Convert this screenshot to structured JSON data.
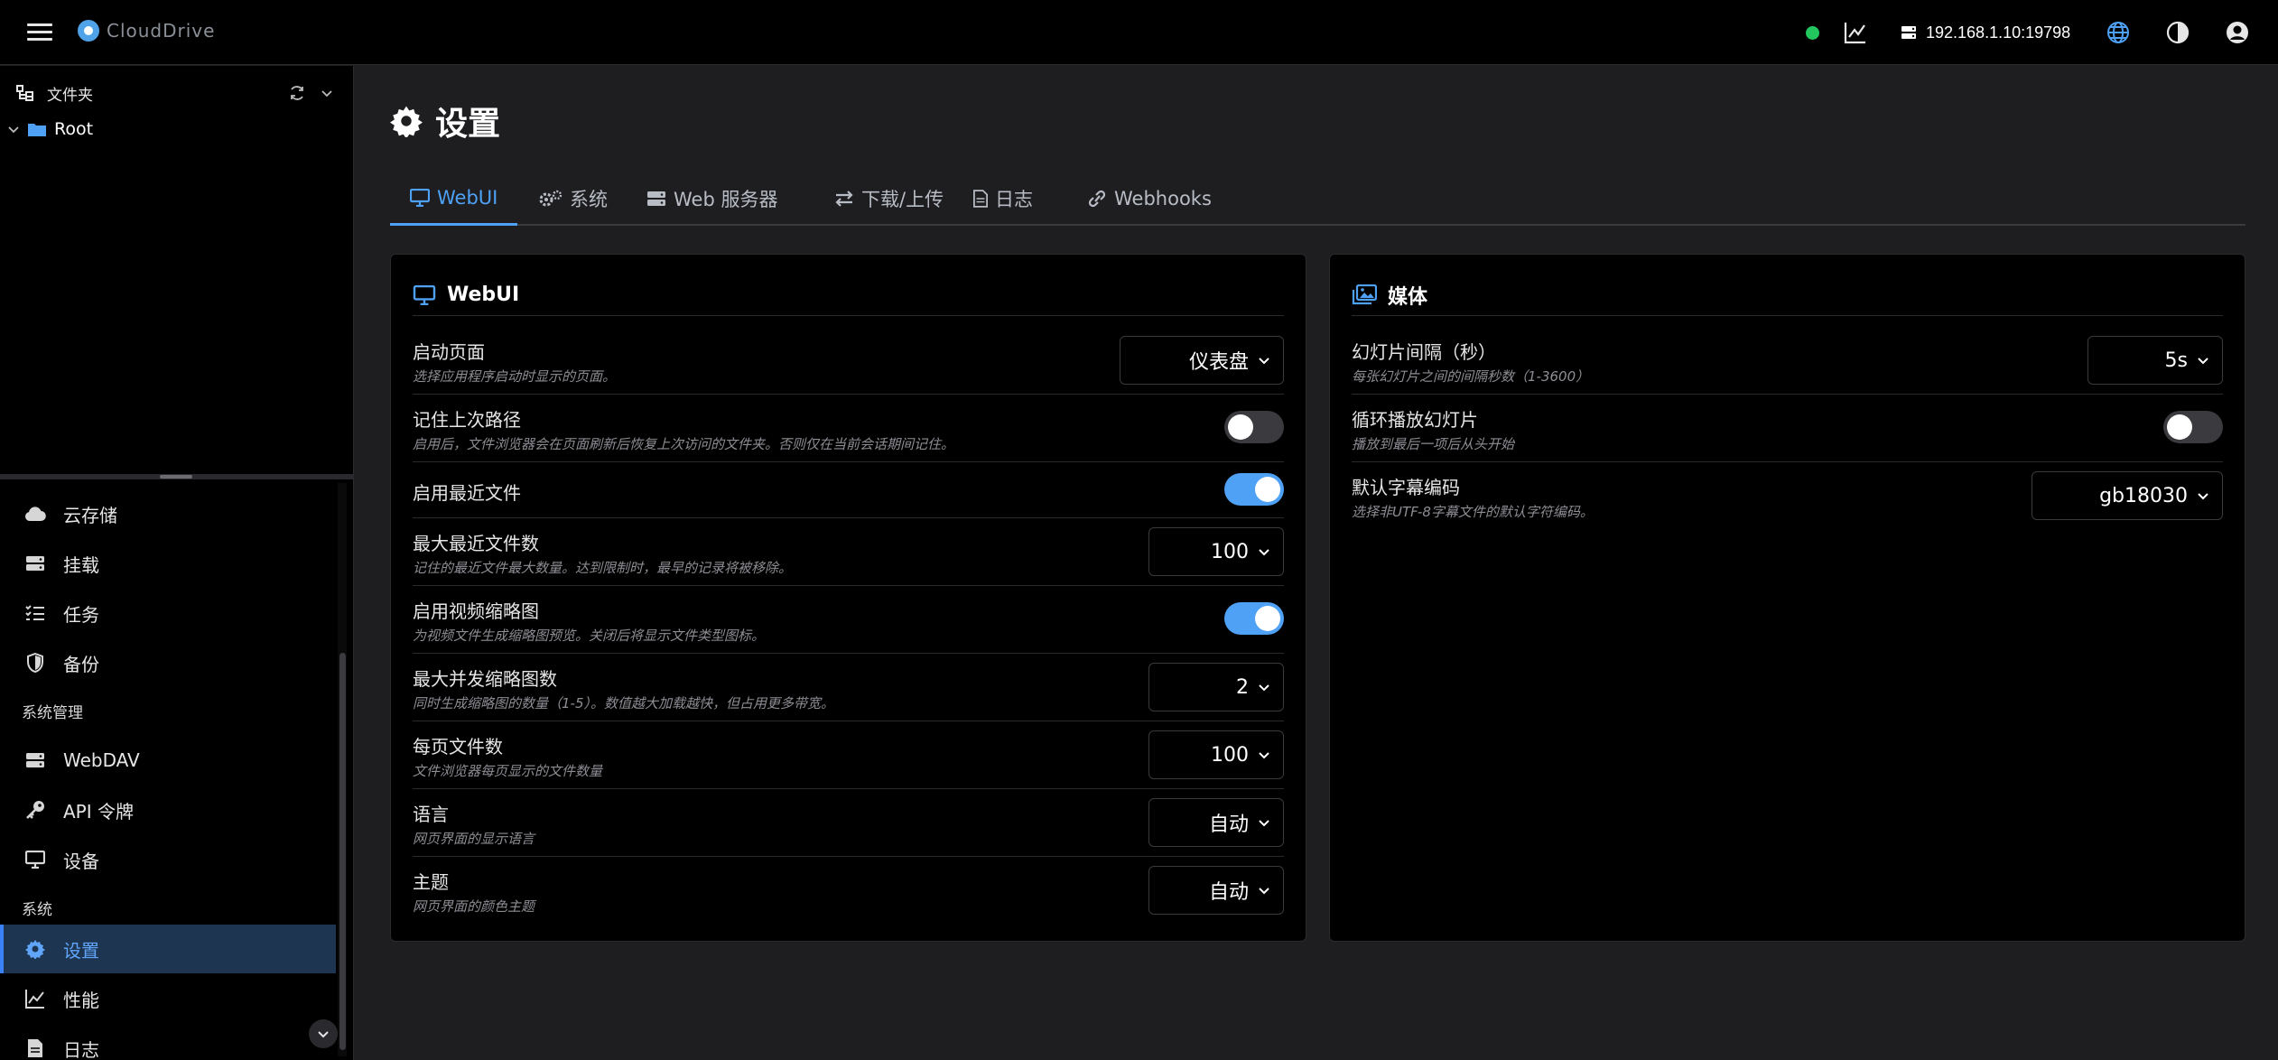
{
  "colors": {
    "accent": "#4ea1f5",
    "status_ok": "#22c55e",
    "background": "#1e1e21",
    "panel": "#000000"
  },
  "topbar": {
    "brand": "CloudDrive",
    "server_address": "192.168.1.10:19798",
    "icons": [
      "menu-icon",
      "status-dot",
      "chart-icon",
      "server-icon",
      "globe-icon",
      "contrast-icon",
      "user-icon"
    ]
  },
  "sidebar": {
    "folder_header": "文件夹",
    "root_folder": "Root",
    "items_top": [
      {
        "label": "云存储",
        "icon": "cloud-icon"
      },
      {
        "label": "挂载",
        "icon": "hdd-icon"
      },
      {
        "label": "任务",
        "icon": "tasks-icon"
      },
      {
        "label": "备份",
        "icon": "shield-icon"
      }
    ],
    "section_admin": "系统管理",
    "items_admin": [
      {
        "label": "WebDAV",
        "icon": "server-icon"
      },
      {
        "label": "API 令牌",
        "icon": "key-icon"
      },
      {
        "label": "设备",
        "icon": "monitor-icon"
      }
    ],
    "section_system": "系统",
    "items_system": [
      {
        "label": "设置",
        "icon": "gear-icon",
        "active": true
      },
      {
        "label": "性能",
        "icon": "chart-icon"
      },
      {
        "label": "日志",
        "icon": "file-icon"
      }
    ]
  },
  "page": {
    "title": "设置",
    "tabs": [
      {
        "label": "WebUI",
        "active": true
      },
      {
        "label": "系统"
      },
      {
        "label": "Web 服务器"
      },
      {
        "label": "下载/上传"
      },
      {
        "label": "日志"
      },
      {
        "label": "Webhooks"
      }
    ]
  },
  "webui_card": {
    "title": "WebUI",
    "rows": [
      {
        "label": "启动页面",
        "desc": "选择应用程序启动时显示的页面。",
        "type": "select",
        "value": "仪表盘"
      },
      {
        "label": "记住上次路径",
        "desc": "启用后，文件浏览器会在页面刷新后恢复上次访问的文件夹。否则仅在当前会话期间记住。",
        "type": "toggle",
        "on": false
      },
      {
        "label": "启用最近文件",
        "desc": "",
        "type": "toggle",
        "on": true
      },
      {
        "label": "最大最近文件数",
        "desc": "记住的最近文件最大数量。达到限制时，最早的记录将被移除。",
        "type": "select",
        "value": "100"
      },
      {
        "label": "启用视频缩略图",
        "desc": "为视频文件生成缩略图预览。关闭后将显示文件类型图标。",
        "type": "toggle",
        "on": true
      },
      {
        "label": "最大并发缩略图数",
        "desc": "同时生成缩略图的数量（1-5）。数值越大加载越快，但占用更多带宽。",
        "type": "select",
        "value": "2"
      },
      {
        "label": "每页文件数",
        "desc": "文件浏览器每页显示的文件数量",
        "type": "select",
        "value": "100"
      },
      {
        "label": "语言",
        "desc": "网页界面的显示语言",
        "type": "select",
        "value": "自动"
      },
      {
        "label": "主题",
        "desc": "网页界面的颜色主题",
        "type": "select",
        "value": "自动"
      }
    ]
  },
  "media_card": {
    "title": "媒体",
    "rows": [
      {
        "label": "幻灯片间隔（秒）",
        "desc": "每张幻灯片之间的间隔秒数（1-3600）",
        "type": "select",
        "value": "5s"
      },
      {
        "label": "循环播放幻灯片",
        "desc": "播放到最后一项后从头开始",
        "type": "toggle",
        "on": false
      },
      {
        "label": "默认字幕编码",
        "desc": "选择非UTF-8字幕文件的默认字符编码。",
        "type": "select",
        "value": "gb18030"
      }
    ]
  }
}
